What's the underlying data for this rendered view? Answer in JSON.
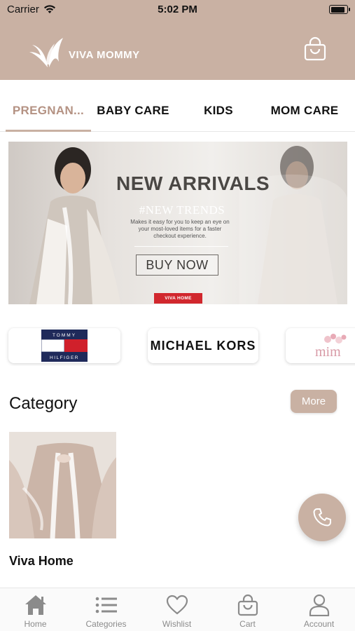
{
  "status_bar": {
    "carrier": "Carrier",
    "time": "5:02 PM"
  },
  "app_bar": {
    "brand_name": "VIVA MOMMY",
    "cart_icon": "shopping-bag-icon"
  },
  "tabs": [
    {
      "label": "PREGNAN...",
      "active": true
    },
    {
      "label": "BABY CARE",
      "active": false
    },
    {
      "label": "KIDS",
      "active": false
    },
    {
      "label": "MOM CARE",
      "active": false
    }
  ],
  "banner": {
    "headline": "NEW ARRIVALS",
    "subhead": "#NEW TRENDS",
    "body": "Makes it easy for you to keep an eye on your most-loved items for a faster checkout experience.",
    "cta": "BUY NOW",
    "tag": "VIVA HOME"
  },
  "brands": [
    {
      "name": "TOMMY HILFIGER",
      "logo_top": "TOMMY",
      "logo_bottom": "HILFIGER"
    },
    {
      "name": "MICHAEL KORS"
    },
    {
      "name": "mim"
    }
  ],
  "category": {
    "title": "Category",
    "more_label": "More",
    "items": [
      {
        "label": "Viva Home"
      }
    ]
  },
  "fab": {
    "icon": "phone-icon"
  },
  "bottom_nav": [
    {
      "label": "Home",
      "icon": "home-icon"
    },
    {
      "label": "Categories",
      "icon": "list-icon"
    },
    {
      "label": "Wishlist",
      "icon": "heart-icon"
    },
    {
      "label": "Cart",
      "icon": "shopping-bag-icon"
    },
    {
      "label": "Account",
      "icon": "user-icon"
    }
  ],
  "colors": {
    "brand": "#c9b1a3",
    "active_tab": "#b49283",
    "tag_red": "#d1272d",
    "nav_inactive": "#8b8b8b"
  }
}
